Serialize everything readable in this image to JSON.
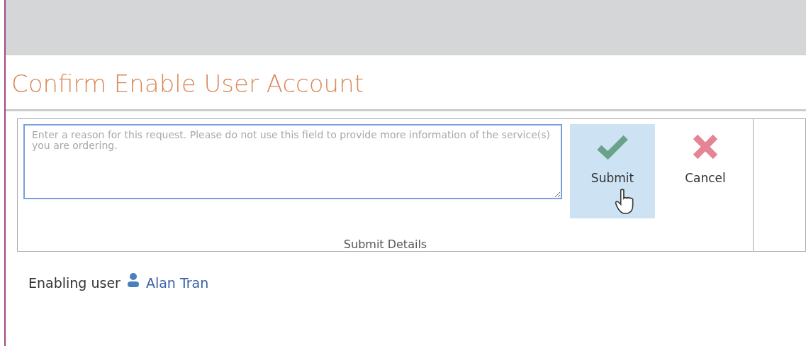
{
  "title": "Confirm Enable User Account",
  "reason_field": {
    "placeholder": "Enter a reason for this request. Please do not use this field to provide more information of the service(s) you are ordering."
  },
  "actions": [
    {
      "kind": "submit",
      "label": "Submit",
      "highlighted": true
    },
    {
      "kind": "cancel",
      "label": "Cancel",
      "highlighted": false
    }
  ],
  "group_label": "Submit Details",
  "user_line": {
    "label": "Enabling user",
    "name": "Alan Tran"
  }
}
